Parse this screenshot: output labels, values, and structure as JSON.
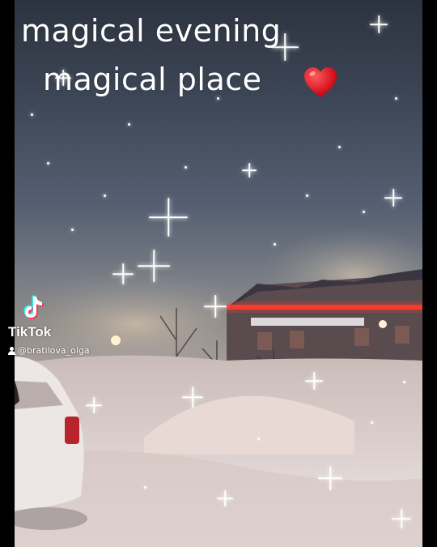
{
  "caption": {
    "line1": "magical evening",
    "line2": "magical place",
    "heart_icon": "red-heart-emoji"
  },
  "watermark": {
    "brand": "TikTok",
    "username": "@bratilova_olga",
    "logo_icon": "tiktok-note-icon",
    "user_icon": "person-icon"
  },
  "colors": {
    "sky_top": "#2c3340",
    "snow": "#e7dedd",
    "house_lights": "#ff3a2a",
    "heart": "#e8101c"
  }
}
